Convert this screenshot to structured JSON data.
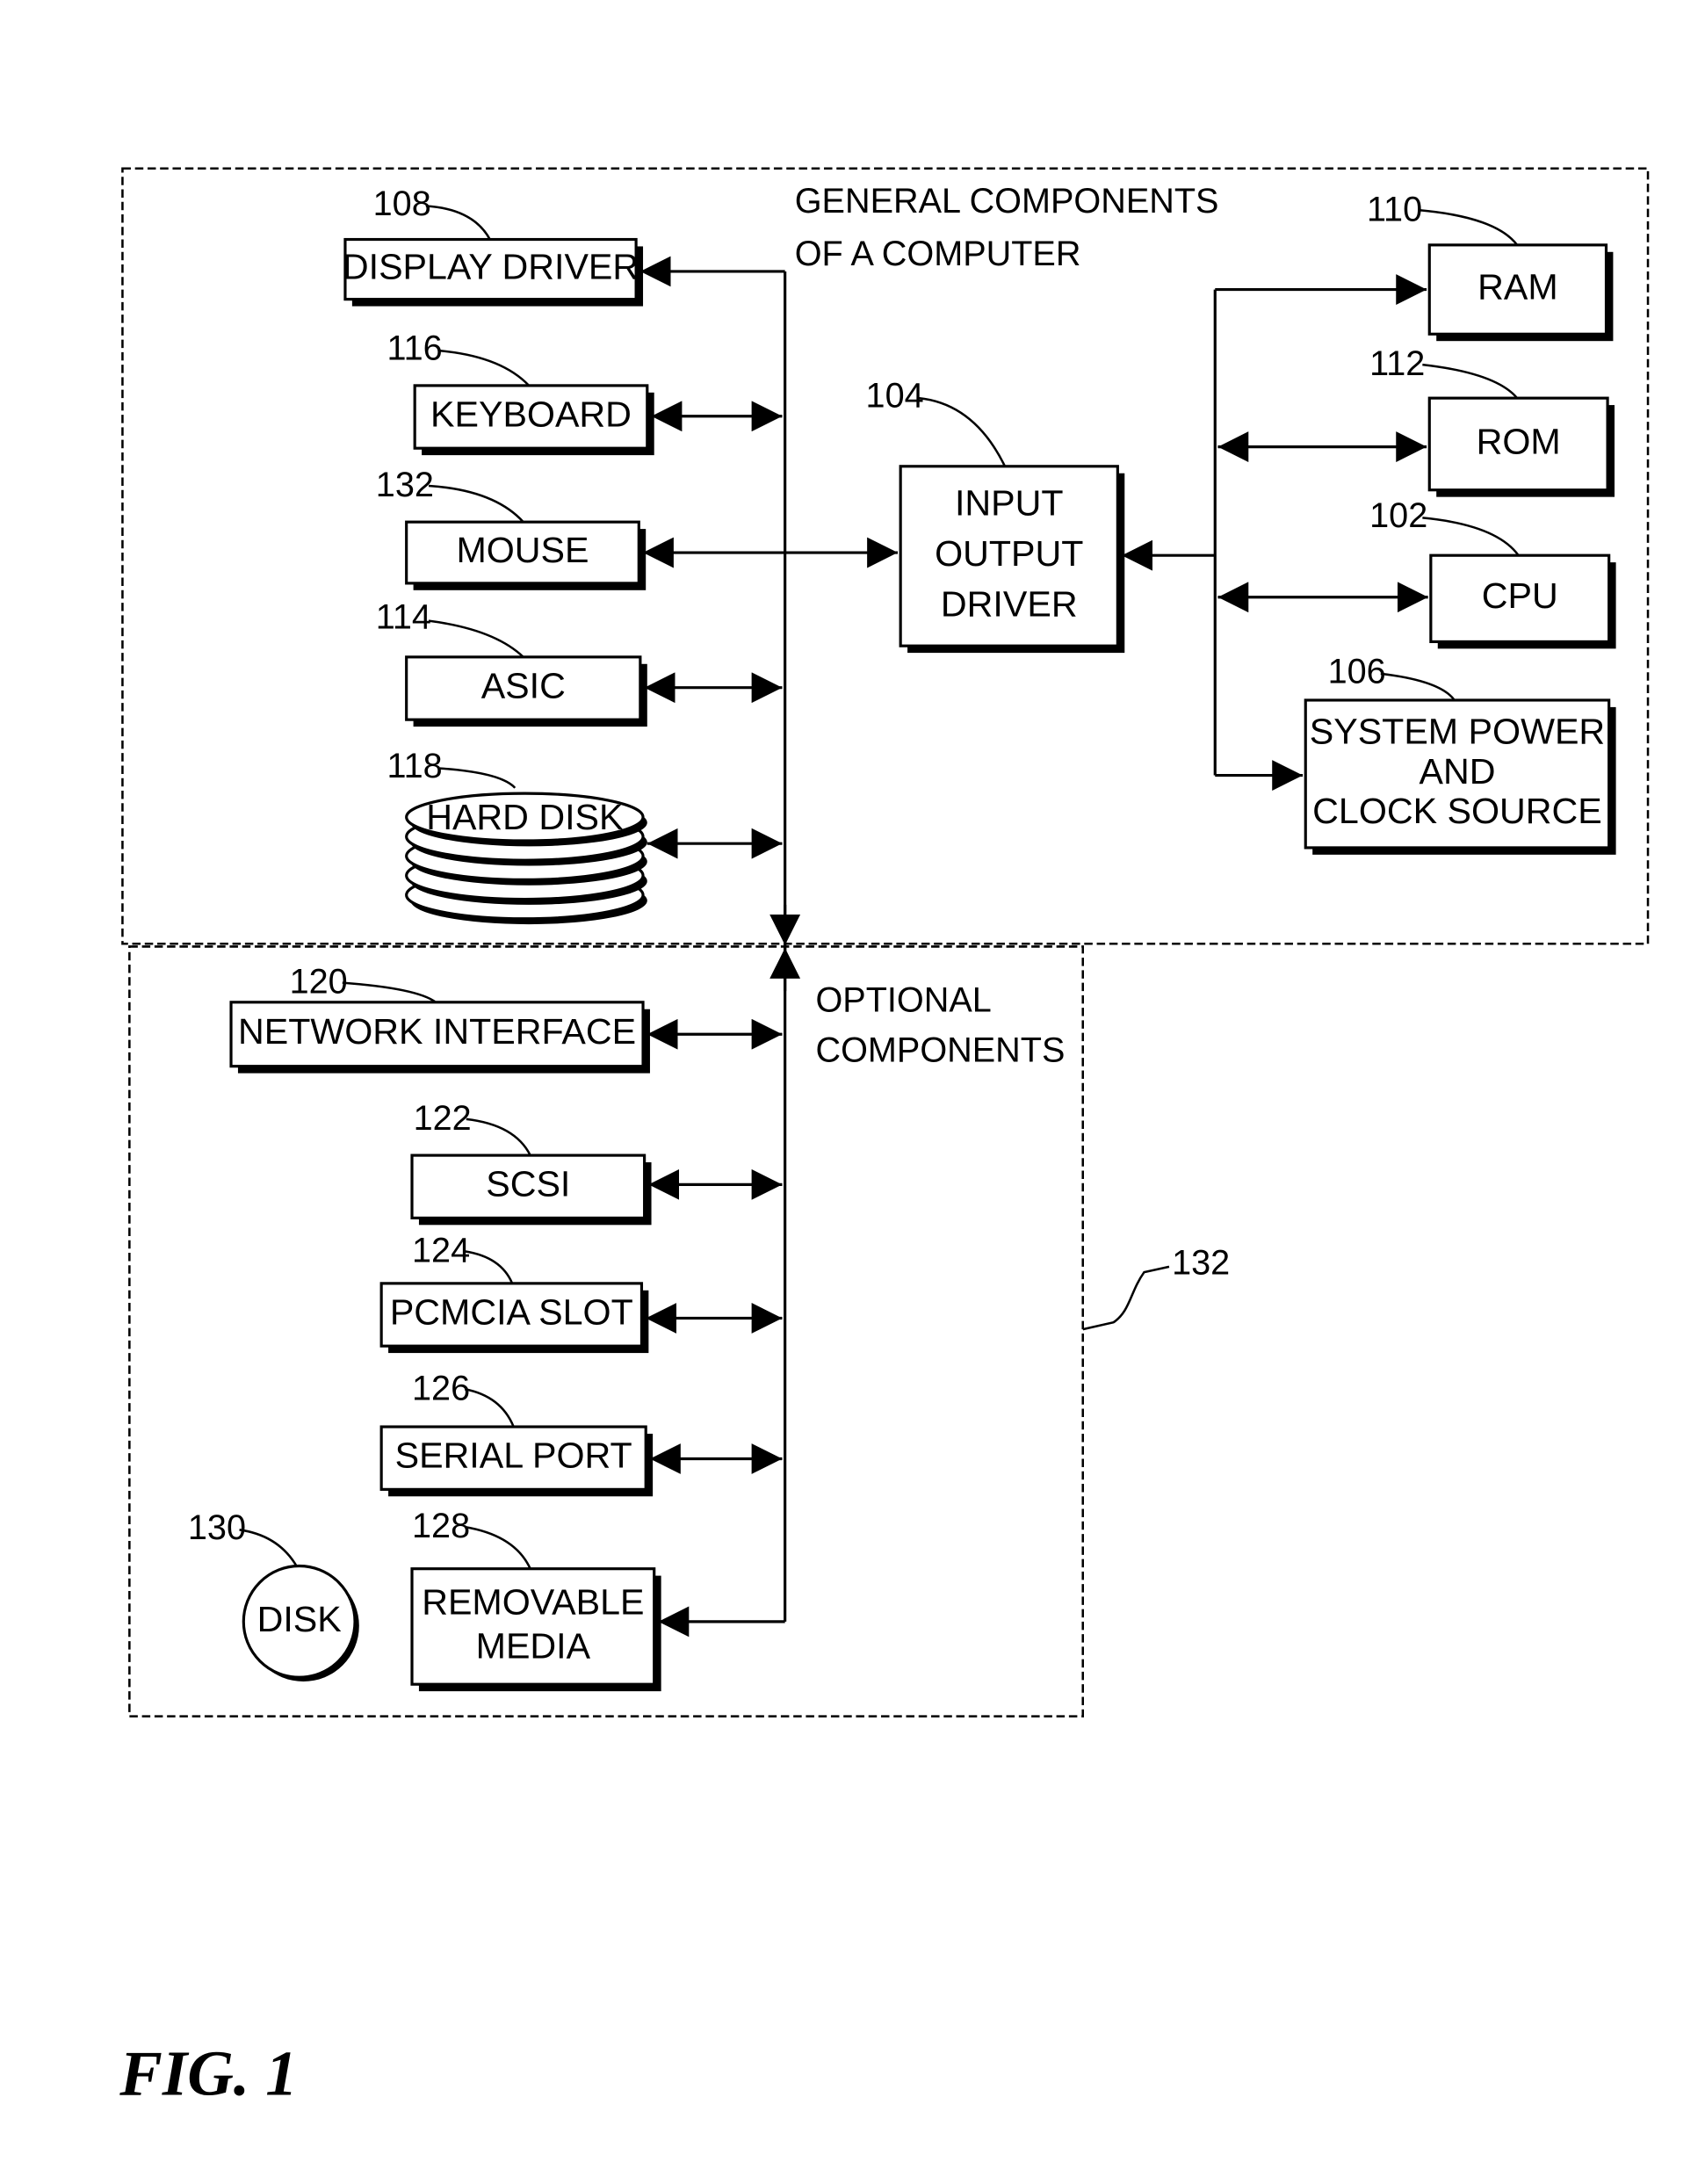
{
  "figure": {
    "caption": "FIG. 1",
    "group_general": {
      "line1": "GENERAL COMPONENTS",
      "line2": "OF A COMPUTER"
    },
    "group_optional": {
      "line1": "OPTIONAL",
      "line2": "COMPONENTS",
      "ref": "132"
    },
    "components": {
      "display_driver": {
        "ref": "108",
        "lines": [
          "DISPLAY DRIVER"
        ]
      },
      "keyboard": {
        "ref": "116",
        "lines": [
          "KEYBOARD"
        ]
      },
      "mouse": {
        "ref": "132",
        "lines": [
          "MOUSE"
        ]
      },
      "asic": {
        "ref": "114",
        "lines": [
          "ASIC"
        ]
      },
      "hard_disk": {
        "ref": "118",
        "lines": [
          "HARD DISK"
        ]
      },
      "io_driver": {
        "ref": "104",
        "lines": [
          "INPUT",
          "OUTPUT",
          "DRIVER"
        ]
      },
      "ram": {
        "ref": "110",
        "lines": [
          "RAM"
        ]
      },
      "rom": {
        "ref": "112",
        "lines": [
          "ROM"
        ]
      },
      "cpu": {
        "ref": "102",
        "lines": [
          "CPU"
        ]
      },
      "system_power": {
        "ref": "106",
        "lines": [
          "SYSTEM  POWER",
          "AND",
          "CLOCK SOURCE"
        ]
      },
      "network_interface": {
        "ref": "120",
        "lines": [
          "NETWORK INTERFACE"
        ]
      },
      "scsi": {
        "ref": "122",
        "lines": [
          "SCSI"
        ]
      },
      "pcmcia_slot": {
        "ref": "124",
        "lines": [
          "PCMCIA SLOT"
        ]
      },
      "serial_port": {
        "ref": "126",
        "lines": [
          "SERIAL PORT"
        ]
      },
      "removable_media": {
        "ref": "128",
        "lines": [
          "REMOVABLE",
          "MEDIA"
        ]
      },
      "disk": {
        "ref": "130",
        "lines": [
          "DISK"
        ]
      }
    }
  }
}
